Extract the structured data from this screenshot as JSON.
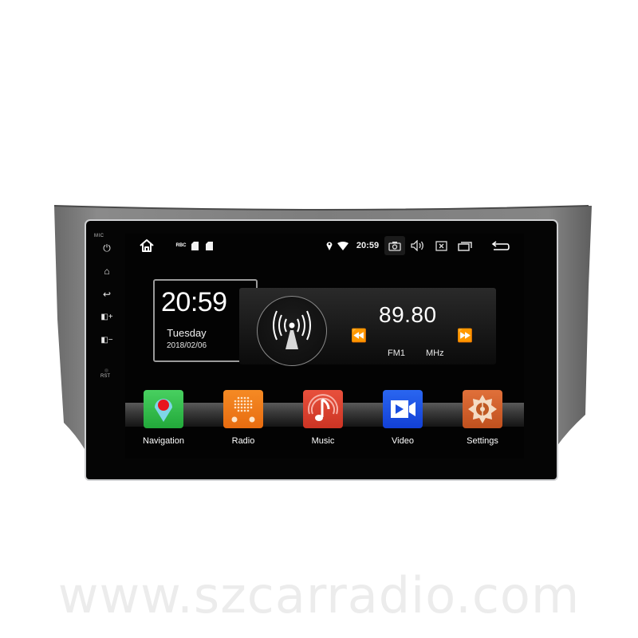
{
  "device": {
    "side_buttons": {
      "mic_label": "MIC",
      "rst_label": "RST",
      "items": [
        {
          "icon": "power-icon",
          "glyph": "⏻"
        },
        {
          "icon": "home-icon",
          "glyph": "⌂"
        },
        {
          "icon": "back-icon",
          "glyph": "↩"
        },
        {
          "icon": "volume-up-icon",
          "glyph": "◧+"
        },
        {
          "icon": "volume-down-icon",
          "glyph": "◧−"
        }
      ]
    }
  },
  "statusbar": {
    "home_icon": "home-icon",
    "left_indicators": [
      "rbc-icon",
      "sd-card-icon",
      "sim-card-icon"
    ],
    "left_text": "RBC",
    "time": "20:59",
    "right_icons": [
      "location-icon",
      "wifi-icon",
      "screenshot-icon",
      "volume-icon",
      "close-app-icon",
      "recent-apps-icon",
      "back-icon"
    ]
  },
  "clock_widget": {
    "time": "20:59",
    "day": "Tuesday",
    "date": "2018/02/06"
  },
  "radio_widget": {
    "frequency": "89.80",
    "band": "FM1",
    "unit": "MHz",
    "prev_icon": "seek-back-icon",
    "next_icon": "seek-forward-icon",
    "prev_glyph": "⏪",
    "next_glyph": "⏩"
  },
  "dock": {
    "apps": [
      {
        "label": "Navigation",
        "color": "#2fb84a"
      },
      {
        "label": "Radio",
        "color": "#f07a1a"
      },
      {
        "label": "Music",
        "color": "#e0402e"
      },
      {
        "label": "Video",
        "color": "#1a4fe0"
      },
      {
        "label": "Settings",
        "color": "#d6602a"
      }
    ]
  },
  "watermark": "www.szcarradio.com"
}
